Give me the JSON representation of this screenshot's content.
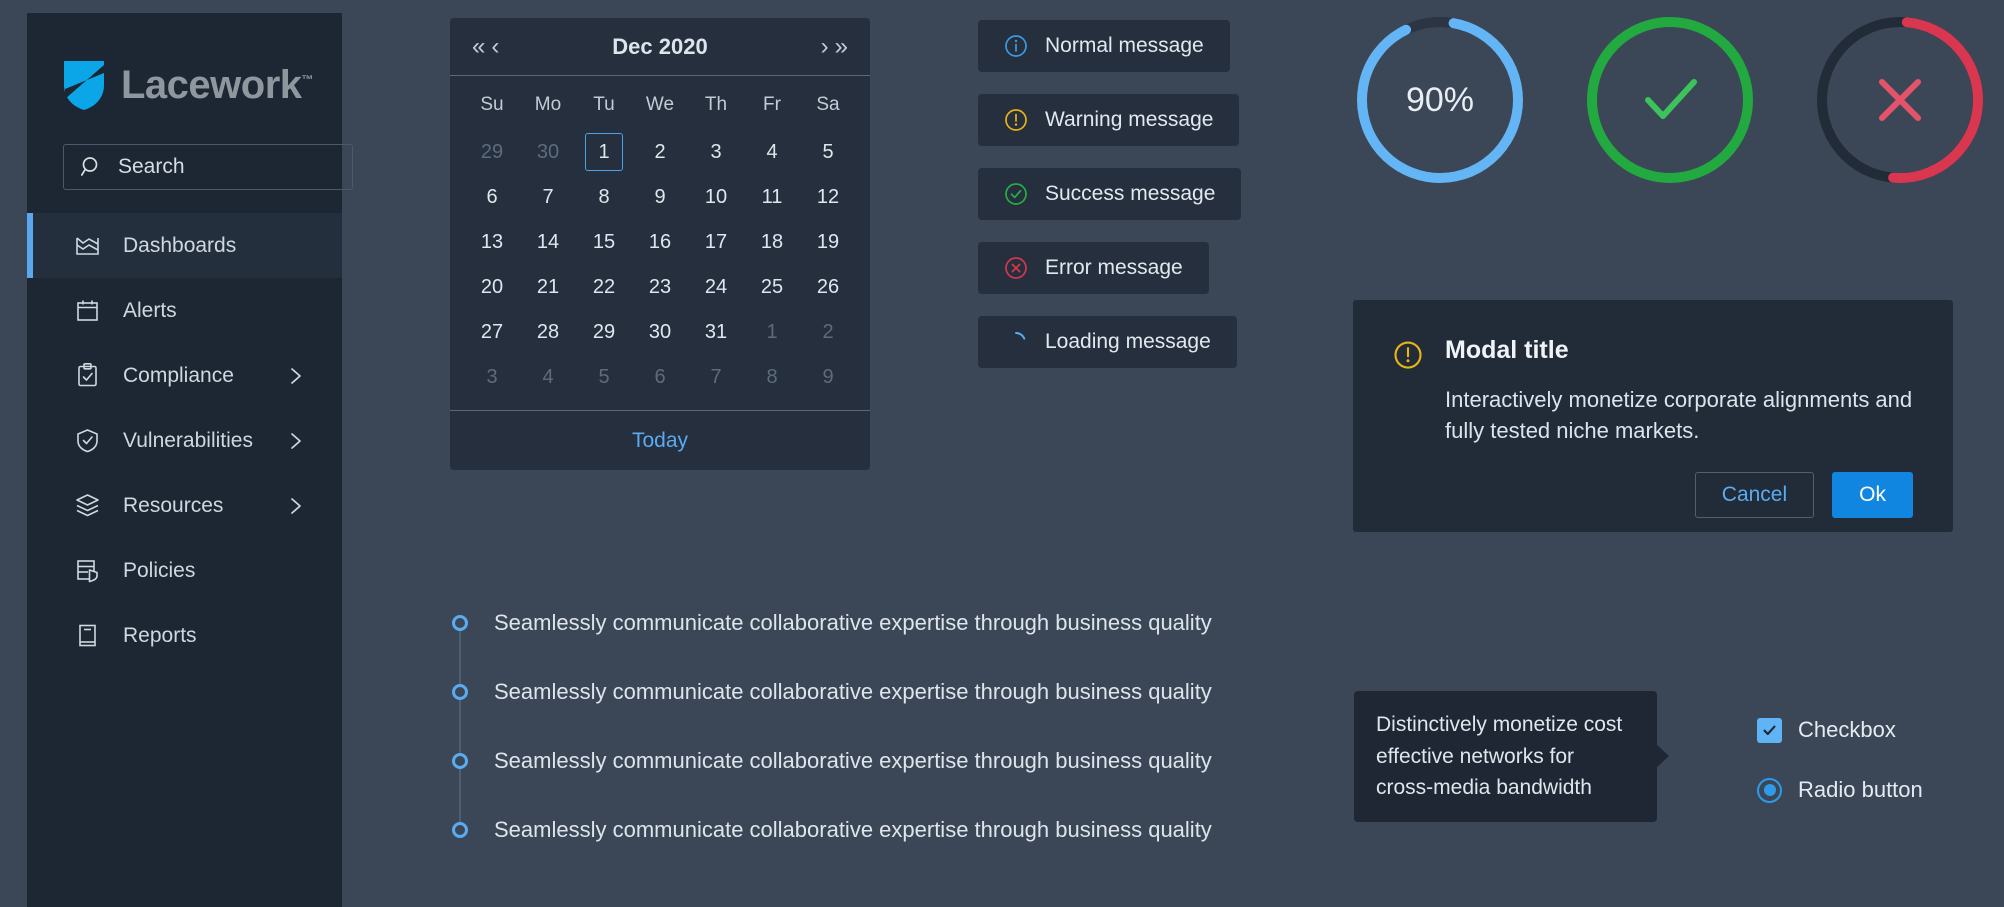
{
  "brand": {
    "name": "Lacework",
    "trademark": "™",
    "logo_color": "#0aa6e8",
    "wordmark_color": "#8e969e"
  },
  "sidebar": {
    "search": {
      "placeholder": "Search",
      "icon": "search-icon"
    },
    "items": [
      {
        "label": "Dashboards",
        "icon": "dashboards-icon",
        "active": true,
        "expandable": false
      },
      {
        "label": "Alerts",
        "icon": "alerts-icon",
        "active": false,
        "expandable": false
      },
      {
        "label": "Compliance",
        "icon": "compliance-icon",
        "active": false,
        "expandable": true
      },
      {
        "label": "Vulnerabilities",
        "icon": "vulnerabilities-icon",
        "active": false,
        "expandable": true
      },
      {
        "label": "Resources",
        "icon": "resources-icon",
        "active": false,
        "expandable": true
      },
      {
        "label": "Policies",
        "icon": "policies-icon",
        "active": false,
        "expandable": false
      },
      {
        "label": "Reports",
        "icon": "reports-icon",
        "active": false,
        "expandable": false
      }
    ]
  },
  "calendar": {
    "title": "Dec 2020",
    "nav": {
      "prev_year": "«",
      "prev_month": "‹",
      "next_month": "›",
      "next_year": "»"
    },
    "weekdays": [
      "Su",
      "Mo",
      "Tu",
      "We",
      "Th",
      "Fr",
      "Sa"
    ],
    "weeks": [
      [
        {
          "d": "29",
          "o": true
        },
        {
          "d": "30",
          "o": true
        },
        {
          "d": "1",
          "o": false,
          "sel": true
        },
        {
          "d": "2",
          "o": false
        },
        {
          "d": "3",
          "o": false
        },
        {
          "d": "4",
          "o": false
        },
        {
          "d": "5",
          "o": false
        }
      ],
      [
        {
          "d": "6",
          "o": false
        },
        {
          "d": "7",
          "o": false
        },
        {
          "d": "8",
          "o": false
        },
        {
          "d": "9",
          "o": false
        },
        {
          "d": "10",
          "o": false
        },
        {
          "d": "11",
          "o": false
        },
        {
          "d": "12",
          "o": false
        }
      ],
      [
        {
          "d": "13",
          "o": false
        },
        {
          "d": "14",
          "o": false
        },
        {
          "d": "15",
          "o": false
        },
        {
          "d": "16",
          "o": false
        },
        {
          "d": "17",
          "o": false
        },
        {
          "d": "18",
          "o": false
        },
        {
          "d": "19",
          "o": false
        }
      ],
      [
        {
          "d": "20",
          "o": false
        },
        {
          "d": "21",
          "o": false
        },
        {
          "d": "22",
          "o": false
        },
        {
          "d": "23",
          "o": false
        },
        {
          "d": "24",
          "o": false
        },
        {
          "d": "25",
          "o": false
        },
        {
          "d": "26",
          "o": false
        }
      ],
      [
        {
          "d": "27",
          "o": false
        },
        {
          "d": "28",
          "o": false
        },
        {
          "d": "29",
          "o": false
        },
        {
          "d": "30",
          "o": false
        },
        {
          "d": "31",
          "o": false
        },
        {
          "d": "1",
          "o": true
        },
        {
          "d": "2",
          "o": true
        }
      ],
      [
        {
          "d": "3",
          "o": true
        },
        {
          "d": "4",
          "o": true
        },
        {
          "d": "5",
          "o": true
        },
        {
          "d": "6",
          "o": true
        },
        {
          "d": "7",
          "o": true
        },
        {
          "d": "8",
          "o": true
        },
        {
          "d": "9",
          "o": true
        }
      ]
    ],
    "today_label": "Today",
    "selected_date": "1",
    "accent_color": "#4aa3e8"
  },
  "messages": [
    {
      "label": "Normal message",
      "icon": "info-circle-icon",
      "color": "#3c9ae0"
    },
    {
      "label": "Warning message",
      "icon": "warning-circle-icon",
      "color": "#e8b416"
    },
    {
      "label": "Success message",
      "icon": "check-circle-icon",
      "color": "#27ae46"
    },
    {
      "label": "Error message",
      "icon": "error-circle-icon",
      "color": "#d8374f"
    },
    {
      "label": "Loading message",
      "icon": "spinner-icon",
      "color": "#5aabf0"
    }
  ],
  "progress": [
    {
      "name": "percent-progress",
      "value": "90%",
      "percent": 90,
      "color": "#64b5f6",
      "track": "#2b3543",
      "icon": ""
    },
    {
      "name": "success-progress",
      "value": "",
      "percent": 100,
      "color": "#22a93f",
      "track": "#2b3543",
      "icon": "check-icon"
    },
    {
      "name": "error-progress",
      "value": "",
      "percent": 50,
      "color": "#d8374f",
      "track": "#222b38",
      "icon": "x-icon"
    }
  ],
  "modal": {
    "icon": "warning-circle-icon",
    "title": "Modal title",
    "body": "Interactively monetize corporate alignments and fully tested niche markets.",
    "cancel_label": "Cancel",
    "ok_label": "Ok",
    "ok_color": "#1186e0"
  },
  "timeline": {
    "items": [
      {
        "text": "Seamlessly communicate collaborative expertise through business quality"
      },
      {
        "text": "Seamlessly communicate collaborative expertise through business quality"
      },
      {
        "text": "Seamlessly communicate collaborative expertise through business quality"
      },
      {
        "text": "Seamlessly communicate collaborative expertise through business quality"
      }
    ],
    "dot_color": "#5aabf0"
  },
  "tooltip": {
    "text": "Distinctively monetize cost effective networks for cross-media bandwidth"
  },
  "controls": {
    "checkbox": {
      "label": "Checkbox",
      "checked": true,
      "color": "#5fb4f5"
    },
    "radio": {
      "label": "Radio button",
      "checked": true,
      "color": "#2e9ae8"
    }
  }
}
